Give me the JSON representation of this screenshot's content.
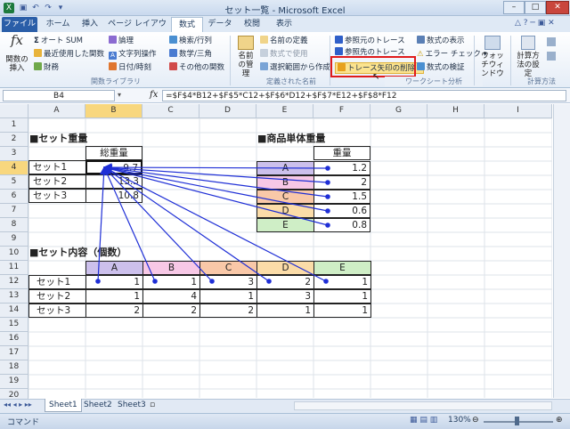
{
  "window": {
    "title": "セット一覧 - Microsoft Excel",
    "min": "–",
    "max": "□",
    "close": "✕"
  },
  "tabs": [
    "ファイル",
    "ホーム",
    "挿入",
    "ページ レイアウト",
    "数式",
    "データ",
    "校閲",
    "表示"
  ],
  "ribbon": {
    "insert_function": "関数の挿入",
    "autosum": "オート SUM",
    "recent": "最近使用した関数",
    "finance": "財務",
    "logical": "論理",
    "text": "文字列操作",
    "datetime": "日付/時刻",
    "lookup": "検索/行列",
    "math": "数学/三角",
    "other": "その他の関数",
    "group_library": "関数ライブラリ",
    "name_manager": "名前の管理",
    "define_name": "名前の定義",
    "use_in_formula": "数式で使用",
    "create_from_sel": "選択範囲から作成",
    "group_names": "定義された名前",
    "trace_precedents": "参照元のトレース",
    "trace_dependents": "参照先のトレース",
    "remove_arrows": "トレース矢印の削除",
    "show_formulas": "数式の表示",
    "error_check": "エラー チェック",
    "evaluate": "数式の検証",
    "group_audit": "ワークシート分析",
    "watch": "ウォッチウィンドウ",
    "calc_options": "計算方法の設定",
    "group_calc": "計算方法"
  },
  "formula_bar": {
    "name_box": "B4",
    "fx": "fx",
    "formula": "=$F$4*B12+$F$5*C12+$F$6*D12+$F$7*E12+$F$8*F12"
  },
  "columns": [
    "A",
    "B",
    "C",
    "D",
    "E",
    "F",
    "G",
    "H",
    "I"
  ],
  "rows": [
    "1",
    "2",
    "3",
    "4",
    "5",
    "6",
    "7",
    "8",
    "9",
    "10",
    "11",
    "12",
    "13",
    "14",
    "15",
    "16",
    "17",
    "18",
    "19",
    "20"
  ],
  "set_weight": {
    "title": "■セット重量",
    "header": "総重量",
    "labels": [
      "セット1",
      "セット2",
      "セット3"
    ],
    "values": [
      "9.7",
      "13.3",
      "10.8"
    ]
  },
  "unit_weight": {
    "title": "■商品単体重量",
    "header": "重量",
    "items": [
      "A",
      "B",
      "C",
      "D",
      "E"
    ],
    "values": [
      "1.2",
      "2",
      "1.5",
      "0.6",
      "0.8"
    ],
    "colors": [
      "#ccc0ec",
      "#f7c8e6",
      "#f9c8a8",
      "#fbdca8",
      "#cfeec6"
    ]
  },
  "set_contents": {
    "title": "■セット内容（個数）",
    "headers": [
      "A",
      "B",
      "C",
      "D",
      "E"
    ],
    "labels": [
      "セット1",
      "セット2",
      "セット3"
    ],
    "rows": [
      [
        "1",
        "1",
        "3",
        "2",
        "1"
      ],
      [
        "1",
        "4",
        "1",
        "3",
        "1"
      ],
      [
        "2",
        "2",
        "2",
        "1",
        "1"
      ]
    ]
  },
  "sheets": [
    "Sheet1",
    "Sheet2",
    "Sheet3"
  ],
  "status": {
    "mode": "コマンド",
    "zoom": "130%"
  },
  "colors": {
    "arrow": "#1f2fd6",
    "highlight": "#e01b1b",
    "selected_header": "#f8d77e"
  }
}
